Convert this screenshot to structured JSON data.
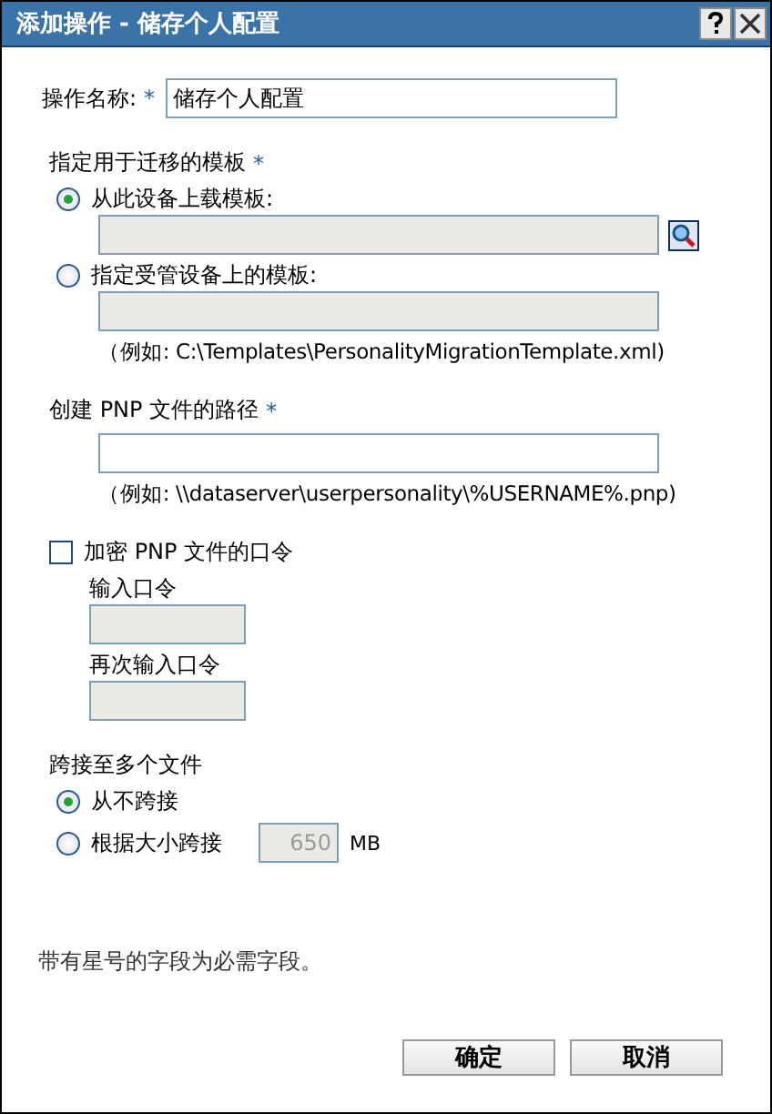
{
  "window": {
    "title": "添加操作 - 储存个人配置"
  },
  "name_field": {
    "label": "操作名称:",
    "required_mark": "*",
    "value": "储存个人配置"
  },
  "template": {
    "heading": "指定用于迁移的模板",
    "required_mark": "*",
    "options": [
      {
        "label": "从此设备上载模板:",
        "selected": true,
        "kind": "browse",
        "field_disabled": true
      },
      {
        "label": "指定受管设备上的模板:",
        "selected": false,
        "kind": "path",
        "field_disabled": true,
        "hint": "（例如: C:\\Templates\\PersonalityMigrationTemplate.xml)"
      }
    ]
  },
  "pnp_path": {
    "heading": "创建 PNP 文件的路径",
    "required_mark": "*",
    "hint": "（例如: \\\\dataserver\\userpersonality\\%USERNAME%.pnp)"
  },
  "encrypt": {
    "label": "加密 PNP 文件的口令",
    "checked": false,
    "fields": [
      {
        "label": "输入口令"
      },
      {
        "label": "再次输入口令"
      }
    ]
  },
  "span": {
    "heading": "跨接至多个文件",
    "options": [
      {
        "label": "从不跨接",
        "selected": true
      },
      {
        "label": "根据大小跨接",
        "selected": false,
        "size": "650",
        "unit": "MB"
      }
    ]
  },
  "note": "带有星号的字段为必需字段。",
  "buttons": [
    "确定",
    "取消"
  ]
}
